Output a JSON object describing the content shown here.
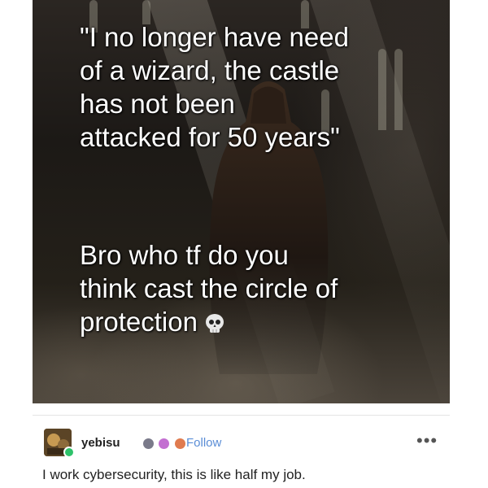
{
  "meme": {
    "quote_lines": [
      "\"I no longer have need",
      "of a wizard, the castle",
      "has not been",
      "attacked for 50 years\""
    ],
    "reply_lines": [
      "Bro who tf do you",
      "think cast the circle of",
      "protection"
    ],
    "reply_emoji": "skull-emoji"
  },
  "post": {
    "username": "yebisu",
    "follow_label": "Follow",
    "more_label": "•••",
    "comment": "I work cybersecurity, this is like half my job.",
    "badge_colors": [
      "#7a7a8a",
      "#c36fd1",
      "#e07b4f"
    ],
    "follow_color": "#5a8dd6"
  }
}
